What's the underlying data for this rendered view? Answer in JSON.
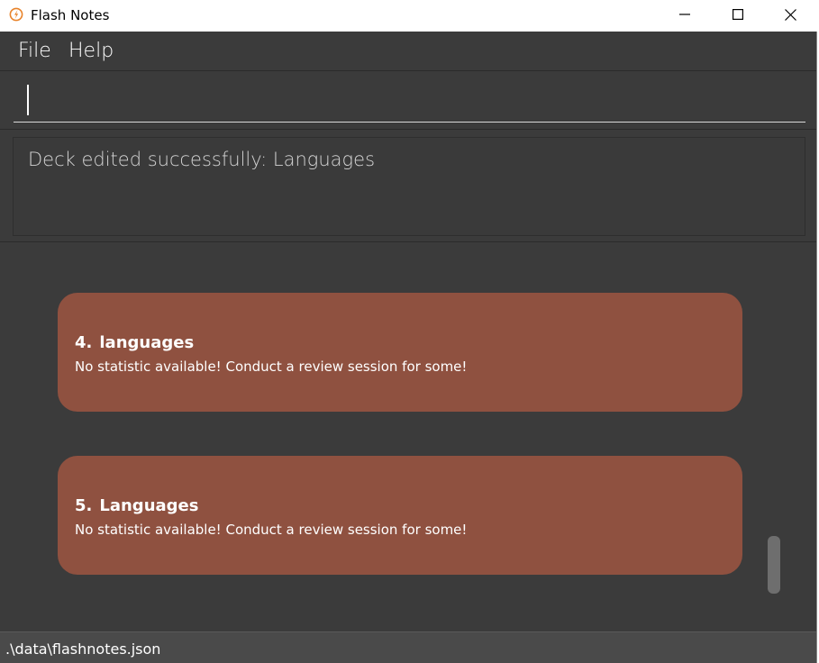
{
  "window": {
    "title": "Flash Notes",
    "icon": "flash-notes-logo-icon"
  },
  "menu": {
    "items": [
      {
        "label": "File"
      },
      {
        "label": "Help"
      }
    ]
  },
  "command": {
    "value": ""
  },
  "result": {
    "message": "Deck edited successfully: Languages"
  },
  "decks": [
    {
      "index": "4.",
      "name": "languages",
      "stats": "No statistic available! Conduct a review session for some!"
    },
    {
      "index": "5.",
      "name": "Languages",
      "stats": "No statistic available! Conduct a review session for some!"
    }
  ],
  "status": {
    "path": ".\\data\\flashnotes.json"
  },
  "colors": {
    "background": "#3b3b3b",
    "card": "#8f5140",
    "status_bar": "#4a4a4a",
    "icon_accent": "#e8832a"
  }
}
